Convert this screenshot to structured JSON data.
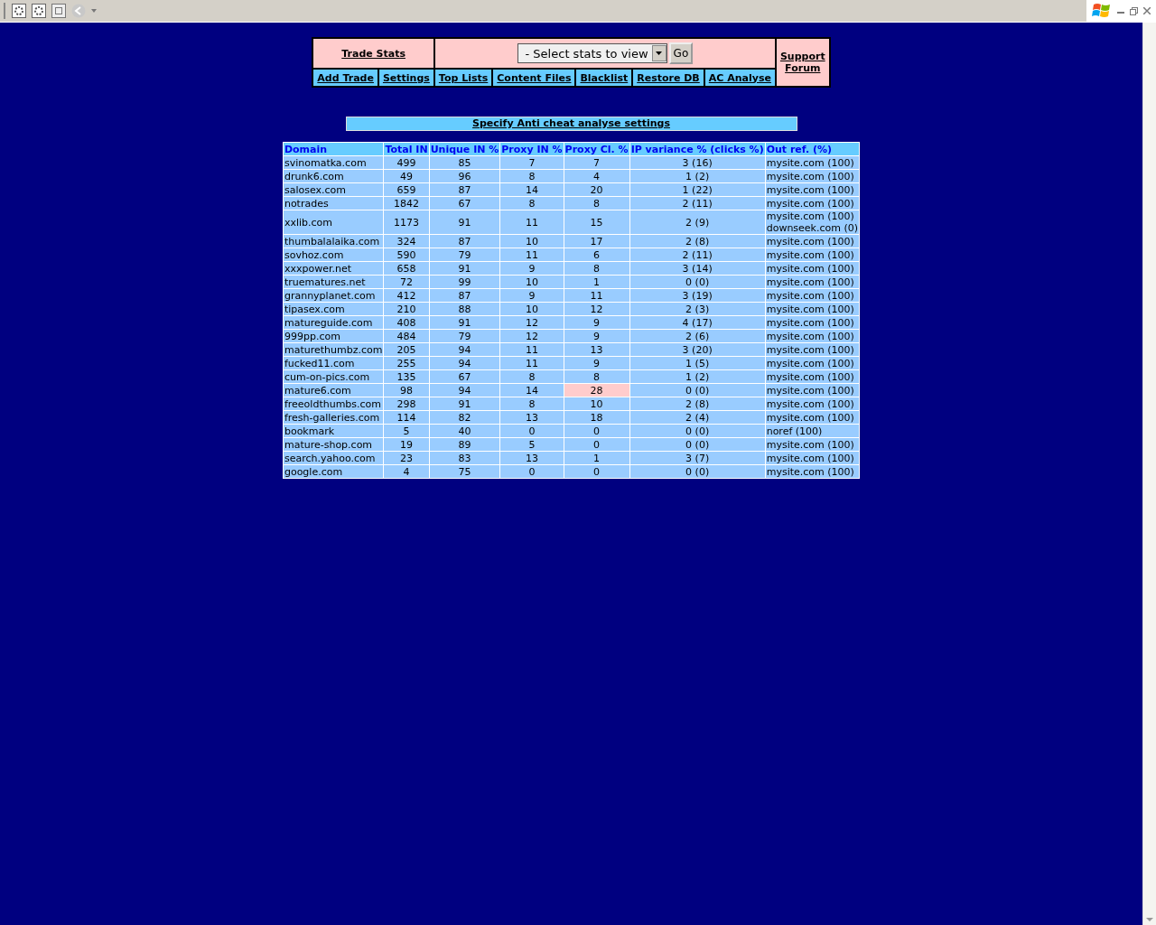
{
  "nav": {
    "title_link": "Trade Stats",
    "select_placeholder": "- Select stats to view",
    "go_button": "Go",
    "support_link": "Support Forum",
    "links": [
      "Add Trade",
      "Settings",
      "Top Lists",
      "Content Files",
      "Blacklist",
      "Restore DB",
      "AC Analyse"
    ]
  },
  "banner_link": "Specify Anti cheat analyse settings",
  "table": {
    "columns": [
      "Domain",
      "Total IN",
      "Unique IN %",
      "Proxy IN %",
      "Proxy Cl. %",
      "IP variance % (clicks %)",
      "Out ref. (%)"
    ],
    "rows": [
      {
        "domain": "svinomatka.com",
        "total_in": "499",
        "unique_in": "85",
        "proxy_in": "7",
        "proxy_cl": "7",
        "proxy_cl_flagged": false,
        "ip_variance": "3 (16)",
        "out_ref": [
          "mysite.com (100)"
        ]
      },
      {
        "domain": "drunk6.com",
        "total_in": "49",
        "unique_in": "96",
        "proxy_in": "8",
        "proxy_cl": "4",
        "proxy_cl_flagged": false,
        "ip_variance": "1 (2)",
        "out_ref": [
          "mysite.com (100)"
        ]
      },
      {
        "domain": "salosex.com",
        "total_in": "659",
        "unique_in": "87",
        "proxy_in": "14",
        "proxy_cl": "20",
        "proxy_cl_flagged": false,
        "ip_variance": "1 (22)",
        "out_ref": [
          "mysite.com (100)"
        ]
      },
      {
        "domain": "notrades",
        "total_in": "1842",
        "unique_in": "67",
        "proxy_in": "8",
        "proxy_cl": "8",
        "proxy_cl_flagged": false,
        "ip_variance": "2 (11)",
        "out_ref": [
          "mysite.com (100)"
        ]
      },
      {
        "domain": "xxlib.com",
        "total_in": "1173",
        "unique_in": "91",
        "proxy_in": "11",
        "proxy_cl": "15",
        "proxy_cl_flagged": false,
        "ip_variance": "2 (9)",
        "out_ref": [
          "mysite.com (100)",
          "downseek.com (0)"
        ]
      },
      {
        "domain": "thumbalalaika.com",
        "total_in": "324",
        "unique_in": "87",
        "proxy_in": "10",
        "proxy_cl": "17",
        "proxy_cl_flagged": false,
        "ip_variance": "2 (8)",
        "out_ref": [
          "mysite.com (100)"
        ]
      },
      {
        "domain": "sovhoz.com",
        "total_in": "590",
        "unique_in": "79",
        "proxy_in": "11",
        "proxy_cl": "6",
        "proxy_cl_flagged": false,
        "ip_variance": "2 (11)",
        "out_ref": [
          "mysite.com (100)"
        ]
      },
      {
        "domain": "xxxpower.net",
        "total_in": "658",
        "unique_in": "91",
        "proxy_in": "9",
        "proxy_cl": "8",
        "proxy_cl_flagged": false,
        "ip_variance": "3 (14)",
        "out_ref": [
          "mysite.com (100)"
        ]
      },
      {
        "domain": "truematures.net",
        "total_in": "72",
        "unique_in": "99",
        "proxy_in": "10",
        "proxy_cl": "1",
        "proxy_cl_flagged": false,
        "ip_variance": "0 (0)",
        "out_ref": [
          "mysite.com (100)"
        ]
      },
      {
        "domain": "grannyplanet.com",
        "total_in": "412",
        "unique_in": "87",
        "proxy_in": "9",
        "proxy_cl": "11",
        "proxy_cl_flagged": false,
        "ip_variance": "3 (19)",
        "out_ref": [
          "mysite.com (100)"
        ]
      },
      {
        "domain": "tipasex.com",
        "total_in": "210",
        "unique_in": "88",
        "proxy_in": "10",
        "proxy_cl": "12",
        "proxy_cl_flagged": false,
        "ip_variance": "2 (3)",
        "out_ref": [
          "mysite.com (100)"
        ]
      },
      {
        "domain": "matureguide.com",
        "total_in": "408",
        "unique_in": "91",
        "proxy_in": "12",
        "proxy_cl": "9",
        "proxy_cl_flagged": false,
        "ip_variance": "4 (17)",
        "out_ref": [
          "mysite.com (100)"
        ]
      },
      {
        "domain": "999pp.com",
        "total_in": "484",
        "unique_in": "79",
        "proxy_in": "12",
        "proxy_cl": "9",
        "proxy_cl_flagged": false,
        "ip_variance": "2 (6)",
        "out_ref": [
          "mysite.com (100)"
        ]
      },
      {
        "domain": "maturethumbz.com",
        "total_in": "205",
        "unique_in": "94",
        "proxy_in": "11",
        "proxy_cl": "13",
        "proxy_cl_flagged": false,
        "ip_variance": "3 (20)",
        "out_ref": [
          "mysite.com (100)"
        ]
      },
      {
        "domain": "fucked11.com",
        "total_in": "255",
        "unique_in": "94",
        "proxy_in": "11",
        "proxy_cl": "9",
        "proxy_cl_flagged": false,
        "ip_variance": "1 (5)",
        "out_ref": [
          "mysite.com (100)"
        ]
      },
      {
        "domain": "cum-on-pics.com",
        "total_in": "135",
        "unique_in": "67",
        "proxy_in": "8",
        "proxy_cl": "8",
        "proxy_cl_flagged": false,
        "ip_variance": "1 (2)",
        "out_ref": [
          "mysite.com (100)"
        ]
      },
      {
        "domain": "mature6.com",
        "total_in": "98",
        "unique_in": "94",
        "proxy_in": "14",
        "proxy_cl": "28",
        "proxy_cl_flagged": true,
        "ip_variance": "0 (0)",
        "out_ref": [
          "mysite.com (100)"
        ]
      },
      {
        "domain": "freeoldthumbs.com",
        "total_in": "298",
        "unique_in": "91",
        "proxy_in": "8",
        "proxy_cl": "10",
        "proxy_cl_flagged": false,
        "ip_variance": "2 (8)",
        "out_ref": [
          "mysite.com (100)"
        ]
      },
      {
        "domain": "fresh-galleries.com",
        "total_in": "114",
        "unique_in": "82",
        "proxy_in": "13",
        "proxy_cl": "18",
        "proxy_cl_flagged": false,
        "ip_variance": "2 (4)",
        "out_ref": [
          "mysite.com (100)"
        ]
      },
      {
        "domain": "bookmark",
        "total_in": "5",
        "unique_in": "40",
        "proxy_in": "0",
        "proxy_cl": "0",
        "proxy_cl_flagged": false,
        "ip_variance": "0 (0)",
        "out_ref": [
          "noref (100)"
        ]
      },
      {
        "domain": "mature-shop.com",
        "total_in": "19",
        "unique_in": "89",
        "proxy_in": "5",
        "proxy_cl": "0",
        "proxy_cl_flagged": false,
        "ip_variance": "0 (0)",
        "out_ref": [
          "mysite.com (100)"
        ]
      },
      {
        "domain": "search.yahoo.com",
        "total_in": "23",
        "unique_in": "83",
        "proxy_in": "13",
        "proxy_cl": "1",
        "proxy_cl_flagged": false,
        "ip_variance": "3 (7)",
        "out_ref": [
          "mysite.com (100)"
        ]
      },
      {
        "domain": "google.com",
        "total_in": "4",
        "unique_in": "75",
        "proxy_in": "0",
        "proxy_cl": "0",
        "proxy_cl_flagged": false,
        "ip_variance": "0 (0)",
        "out_ref": [
          "mysite.com (100)"
        ]
      }
    ]
  }
}
